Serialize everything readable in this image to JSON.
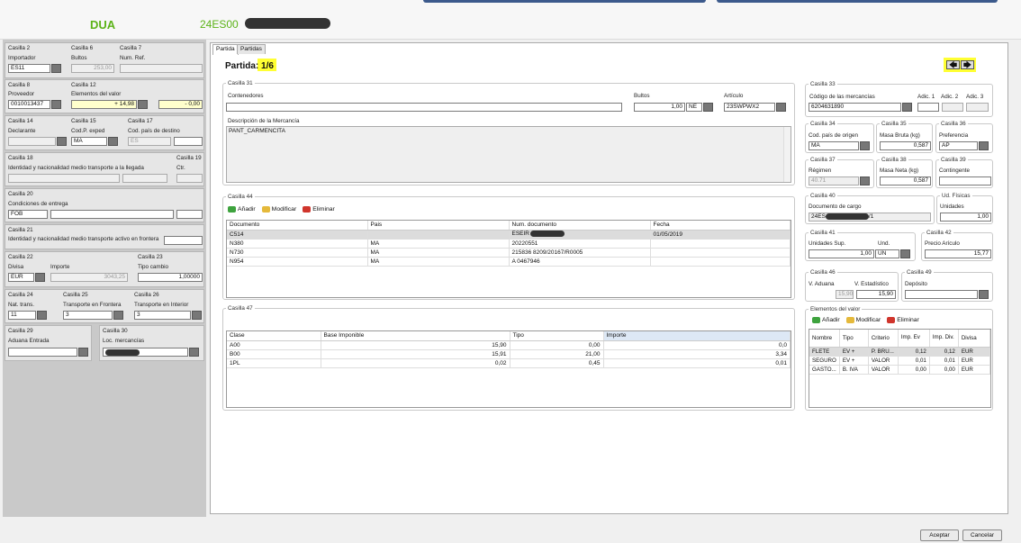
{
  "header": {
    "app_title": "DUA",
    "reference": "24ES00"
  },
  "left": {
    "c2": {
      "title": "Casilla 2",
      "label": "Importador",
      "value": "ES11"
    },
    "c6": {
      "title": "Casilla 6",
      "label": "Bultos",
      "value": "253,00"
    },
    "c7": {
      "title": "Casilla 7",
      "label": "Num. Ref."
    },
    "c8": {
      "title": "Casilla 8",
      "label": "Proveedor",
      "value": "0010013437"
    },
    "c12": {
      "title": "Casilla 12",
      "label": "Elementos del valor",
      "value1": "+ 14,98",
      "value2": "- 0,00"
    },
    "c14": {
      "title": "Casilla 14",
      "label": "Declarante"
    },
    "c15": {
      "title": "Casilla 15",
      "label": "Cod.P. exped",
      "value": "MA"
    },
    "c17": {
      "title": "Casilla 17",
      "label": "Cod. país de destino",
      "value": "ES"
    },
    "c18": {
      "title": "Casilla 18",
      "label": "Identidad y nacionalidad medio transporte a la llegada",
      "ctr": "Ctr."
    },
    "c19": {
      "title": "Casilla 19"
    },
    "c20": {
      "title": "Casilla 20",
      "label": "Condiciones de entrega",
      "value": "FOB"
    },
    "c21": {
      "title": "Casilla 21",
      "label": "Identidad y nacionalidad medio transporte activo en frontera"
    },
    "c22": {
      "title": "Casilla 22",
      "label": "Divisa",
      "label2": "Importe",
      "value": "EUR",
      "importe": "3043,25"
    },
    "c23": {
      "title": "Casilla 23",
      "label": "Tipo cambio",
      "value": "1,00000"
    },
    "c24": {
      "title": "Casilla 24",
      "label": "Nat. trans.",
      "value": "11"
    },
    "c25": {
      "title": "Casilla 25",
      "label": "Transporte en Frontera",
      "value": "3"
    },
    "c26": {
      "title": "Casilla 26",
      "label": "Transporte en Interior",
      "value": "3"
    },
    "c29": {
      "title": "Casilla 29",
      "label": "Aduana Entrada"
    },
    "c30": {
      "title": "Casilla 30",
      "label": "Loc. mercancías"
    }
  },
  "tabs": [
    {
      "label": "Partida"
    },
    {
      "label": "Partidas"
    }
  ],
  "partida": {
    "label": "Partida:",
    "value": "1/6"
  },
  "nav": {
    "prev": "🡄",
    "next": "🡆"
  },
  "c31": {
    "title": "Casilla 31",
    "contenedores": "Contenedores",
    "bultos_label": "Bultos",
    "bultos_value": "1,00",
    "bultos_unit": "NE",
    "articulo_label": "Artículo",
    "articulo_value": "23SWPWX2",
    "desc_label": "Descripción de la Mercancía",
    "desc_value": "PANT_CARMENCITA"
  },
  "c44": {
    "title": "Casilla 44",
    "add": "Añadir",
    "edit": "Modificar",
    "del": "Eliminar",
    "columns": [
      "Documento",
      "Pais",
      "Num. documento",
      "Fecha"
    ],
    "rows": [
      [
        "C514",
        "",
        "ESEIR",
        "01/05/2019"
      ],
      [
        "N380",
        "MA",
        "20220551",
        ""
      ],
      [
        "N730",
        "MA",
        "215836 8209/20167/R0005",
        ""
      ],
      [
        "N954",
        "MA",
        "A 0467946",
        ""
      ]
    ]
  },
  "c47": {
    "title": "Casilla 47",
    "columns": [
      "Clase",
      "Base Imponible",
      "Tipo",
      "Importe"
    ],
    "rows": [
      [
        "A00",
        "15,90",
        "0,00",
        "0,0"
      ],
      [
        "B00",
        "15,91",
        "21,00",
        "3,34"
      ],
      [
        "1PL",
        "0,02",
        "0,45",
        "0,01"
      ]
    ]
  },
  "c33": {
    "title": "Casilla 33",
    "label": "Código de las mercancías",
    "value": "6204631890",
    "adic1": "Adic. 1",
    "adic2": "Adic. 2",
    "adic3": "Adic. 3"
  },
  "c34": {
    "title": "Casilla 34",
    "label": "Cod. país de origen",
    "value": "MA"
  },
  "c35": {
    "title": "Casilla 35",
    "label": "Masa Bruta (kg)",
    "value": "0,587"
  },
  "c36": {
    "title": "Casilla 36",
    "label": "Preferencia",
    "value": "AP"
  },
  "c37": {
    "title": "Casilla 37",
    "label": "Régimen",
    "value": "40.71"
  },
  "c38": {
    "title": "Casilla 38",
    "label": "Masa Neta (kg)",
    "value": "0,587"
  },
  "c39": {
    "title": "Casilla 39",
    "label": "Contingente"
  },
  "c40": {
    "title": "Casilla 40",
    "label": "Documento de cargo",
    "value_a": "24ES",
    "value_b": "/1"
  },
  "udfis": {
    "title": "Ud. Físicas",
    "label": "Unidades",
    "value": "1,00"
  },
  "c41": {
    "title": "Casilla 41",
    "label": "Unidades Sup.",
    "und_label": "Und.",
    "value": "1,00",
    "und": "UN"
  },
  "c42": {
    "title": "Casilla 42",
    "label": "Precio Arículo",
    "value": "15,77"
  },
  "c46": {
    "title": "Casilla 46",
    "label": "V. Aduana",
    "value": "15,90",
    "label2": "V. Estadístico",
    "value2": "15,90"
  },
  "c49": {
    "title": "Casilla 49",
    "label": "Depósito"
  },
  "ev": {
    "title": "Elementos del valor",
    "add": "Añadir",
    "edit": "Modificar",
    "del": "Eliminar",
    "columns": [
      "Nombre",
      "Tipo",
      "Criterio",
      "Imp. Ev",
      "Imp. Div.",
      "Divisa"
    ],
    "rows": [
      [
        "FLETE",
        "EV +",
        "P. BRU...",
        "0,12",
        "0,12",
        "EUR"
      ],
      [
        "SEGURO",
        "EV +",
        "VALOR",
        "0,01",
        "0,01",
        "EUR"
      ],
      [
        "GASTO...",
        "B. IVA",
        "VALOR",
        "0,00",
        "0,00",
        "EUR"
      ]
    ]
  },
  "footer": {
    "accept": "Aceptar",
    "cancel": "Cancelar"
  }
}
